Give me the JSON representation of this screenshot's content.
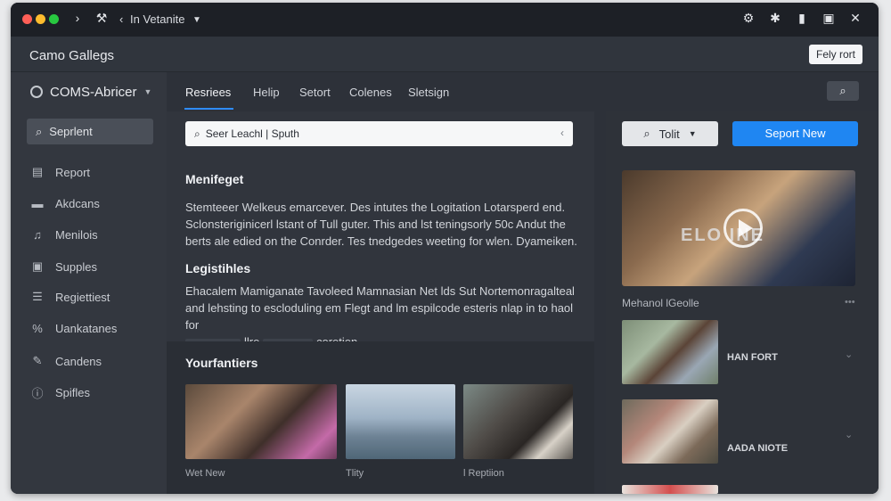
{
  "window": {
    "title": "In Vetanite",
    "colors": {
      "close": "#ff5f57",
      "minimize": "#febc2e",
      "maximize": "#28c840",
      "accent": "#1f86f2"
    }
  },
  "header": {
    "app_title": "Camo Gallegs",
    "action_button": "Fely rort"
  },
  "sidebar": {
    "workspace": "COMS-Abricer",
    "search_label": "Seprlent",
    "items": [
      {
        "label": "Report",
        "icon": "report-icon"
      },
      {
        "label": "Akdcans",
        "icon": "folder-icon"
      },
      {
        "label": "Menilois",
        "icon": "music-icon"
      },
      {
        "label": "Supples",
        "icon": "image-icon"
      },
      {
        "label": "Regiettiest",
        "icon": "list-icon"
      },
      {
        "label": "Uankatanes",
        "icon": "percent-icon"
      },
      {
        "label": "Candens",
        "icon": "pen-icon"
      },
      {
        "label": "Spifles",
        "icon": "info-icon"
      }
    ]
  },
  "tabs": [
    {
      "label": "Resriees",
      "active": true
    },
    {
      "label": "Helip"
    },
    {
      "label": "Setort"
    },
    {
      "label": "Colenes"
    },
    {
      "label": "Sletsign"
    }
  ],
  "content": {
    "search_value": "Seer Leachl | Sputh",
    "sections": [
      {
        "title": "Menifeget",
        "lines": [
          "Stemteeer Welkeus emarcever. Des intutes the Logitation Lotarsperd end.",
          "Sclonsteriginicerl lstant of Tull guter. This and lst teningsorly 50c Andut the",
          "berts ale edied on the Conrder. Tes tnedgedes weeting for wlen. Dyameiken."
        ]
      },
      {
        "title": "Legistihles",
        "lines": [
          "Ehacalem Mamiganate Tavoleed Mamnasian Net lds Sut Nortemonragalteal",
          "and lehsting to escloduling em Flegt and lm espilcode esteris nlap in to haol for",
          "llre",
          "coretien."
        ]
      }
    ],
    "gallery": {
      "title": "Yourfantiers",
      "items": [
        {
          "caption": "Wet New"
        },
        {
          "caption": "Tlity"
        },
        {
          "caption": "l Reptiion"
        }
      ]
    }
  },
  "right": {
    "tool_label": "Tolit",
    "primary_label": "Seport New",
    "video_caption": "Mehanol lGeolle",
    "video_overlay": "ELO INE",
    "items": [
      {
        "label": "HAN FORT"
      },
      {
        "label": "AADA NIOTE"
      }
    ]
  }
}
